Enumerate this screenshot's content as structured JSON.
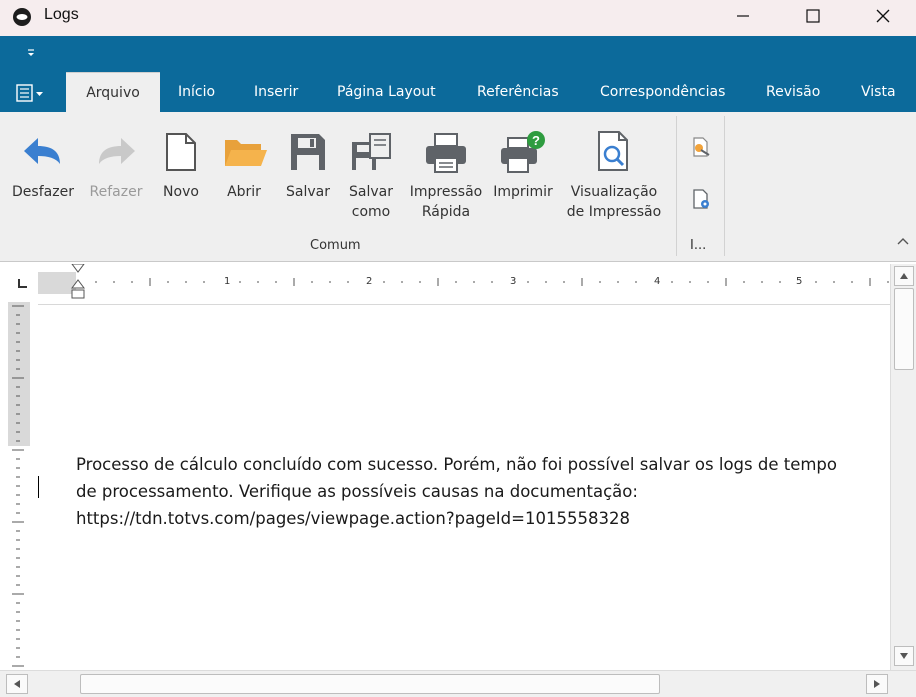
{
  "window": {
    "title": "Logs",
    "icon": "totvs-logo-icon",
    "controls": [
      "minimize-icon",
      "maximize-icon",
      "close-icon"
    ]
  },
  "qat": {
    "dropdown_icon": "chevron-down-icon"
  },
  "tabs": [
    {
      "label": "Arquivo",
      "active": true
    },
    {
      "label": "Início",
      "active": false
    },
    {
      "label": "Inserir",
      "active": false
    },
    {
      "label": "Página Layout",
      "active": false
    },
    {
      "label": "Referências",
      "active": false
    },
    {
      "label": "Correspondências",
      "active": false
    },
    {
      "label": "Revisão",
      "active": false
    },
    {
      "label": "Vista",
      "active": false
    }
  ],
  "ribbon": {
    "buttons": [
      {
        "line1": "Desfazer",
        "line2": "",
        "icon": "undo-icon",
        "enabled": true
      },
      {
        "line1": "Refazer",
        "line2": "",
        "icon": "redo-icon",
        "enabled": false
      },
      {
        "line1": "Novo",
        "line2": "",
        "icon": "new-document-icon",
        "enabled": true
      },
      {
        "line1": "Abrir",
        "line2": "",
        "icon": "open-folder-icon",
        "enabled": true
      },
      {
        "line1": "Salvar",
        "line2": "",
        "icon": "save-icon",
        "enabled": true
      },
      {
        "line1": "Salvar",
        "line2": "como",
        "icon": "save-as-icon",
        "enabled": true
      },
      {
        "line1": "Impressão",
        "line2": "Rápida",
        "icon": "quick-print-icon",
        "enabled": true
      },
      {
        "line1": "Imprimir",
        "line2": "",
        "icon": "print-icon",
        "enabled": true
      },
      {
        "line1": "Visualização",
        "line2": "de Impressão",
        "icon": "print-preview-icon",
        "enabled": true
      }
    ],
    "group_label": "Comum",
    "info_group_label": "I...",
    "info_icons": [
      "document-key-icon",
      "document-settings-icon"
    ]
  },
  "ruler": {
    "marks": [
      "1",
      "2",
      "3",
      "4",
      "5"
    ]
  },
  "document": {
    "lines": [
      "Processo de cálculo concluído com sucesso. Porém, não foi possível salvar os logs de tempo",
      "de processamento. Verifique as possíveis causas na documentação:",
      "https://tdn.totvs.com/pages/viewpage.action?pageId=1015558328"
    ]
  },
  "colors": {
    "ribbon_blue": "#0c6a9b",
    "ribbon_bg": "#efefef",
    "titlebar_bg": "#f6edee",
    "icon_blue": "#3a7fd0",
    "icon_orange": "#f2a33a",
    "icon_gray": "#5f6368",
    "icon_green": "#2e9c3f"
  }
}
